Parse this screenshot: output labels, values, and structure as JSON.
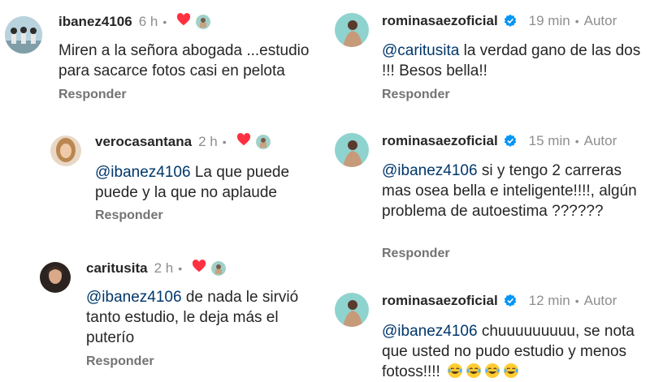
{
  "left": [
    {
      "user": "ibanez4106",
      "time": "6 h",
      "mention": "",
      "text": "Miren a la señora abogada ...estudio para sacarce fotos  casi en pelota",
      "reply": "Responder"
    },
    {
      "user": "verocasantana",
      "time": "2 h",
      "mention": "@ibanez4106",
      "text": " La que puede puede y la que no aplaude",
      "reply": "Responder"
    },
    {
      "user": "caritusita",
      "time": "2 h",
      "mention": "@ibanez4106",
      "text": " de nada le sirvió tanto estudio, le deja más el puterío",
      "reply": "Responder"
    }
  ],
  "right": [
    {
      "user": "rominasaezoficial",
      "time": "19 min",
      "author": "Autor",
      "mention": "@caritusita",
      "text": " la verdad gano de las dos !!! Besos bella!!",
      "reply": "Responder"
    },
    {
      "user": "rominasaezoficial",
      "time": "15 min",
      "author": "Autor",
      "mention": "@ibanez4106",
      "text": " si y tengo 2 carreras mas osea bella e inteligente!!!!, algún problema de autoestima ??????",
      "reply": "Responder"
    },
    {
      "user": "rominasaezoficial",
      "time": "12 min",
      "author": "Autor",
      "mention": "@ibanez4106",
      "text": " chuuuuuuuuu, se nota que usted no pudo estudio y menos fotoss!!!!",
      "emoji": "laughing-tears-emoji x4"
    }
  ],
  "colors": {
    "heart": "#ff3040",
    "verified": "#0095f6",
    "mention": "#00376b",
    "meta": "#8e8e8e"
  }
}
